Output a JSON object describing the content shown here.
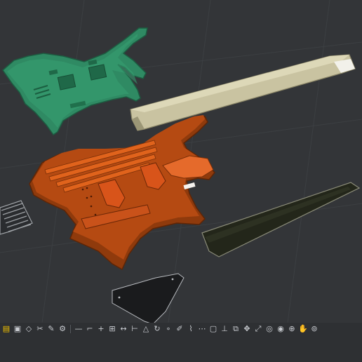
{
  "viewport": {
    "background": "#333538",
    "grid_color": "#3f4245",
    "objects": [
      {
        "name": "green-body-part",
        "color": "#2f8a63"
      },
      {
        "name": "neck-part",
        "color": "#c9c3a1"
      },
      {
        "name": "orange-body-part",
        "color": "#b54a12"
      },
      {
        "name": "fretboard-part",
        "color": "#23261a"
      },
      {
        "name": "hardware-part",
        "color": "#8a8d91"
      },
      {
        "name": "pickguard-part",
        "color": "#1a1b1d"
      }
    ]
  },
  "toolbar": {
    "icons": [
      "file-icon",
      "image-icon",
      "select-icon",
      "scissors-icon",
      "paint-icon",
      "gear-icon",
      "line-icon",
      "bracket-icon",
      "plus-icon",
      "grid-icon",
      "measure-icon",
      "ruler-icon",
      "triangle-icon",
      "rotate-icon",
      "node-icon",
      "pen-icon",
      "brush-icon",
      "dots-icon",
      "frame-icon",
      "axis-icon",
      "copy-icon",
      "move-icon",
      "scale-icon",
      "view-icon",
      "camera-icon",
      "zoom-icon",
      "hand-icon",
      "orbit-icon"
    ]
  }
}
